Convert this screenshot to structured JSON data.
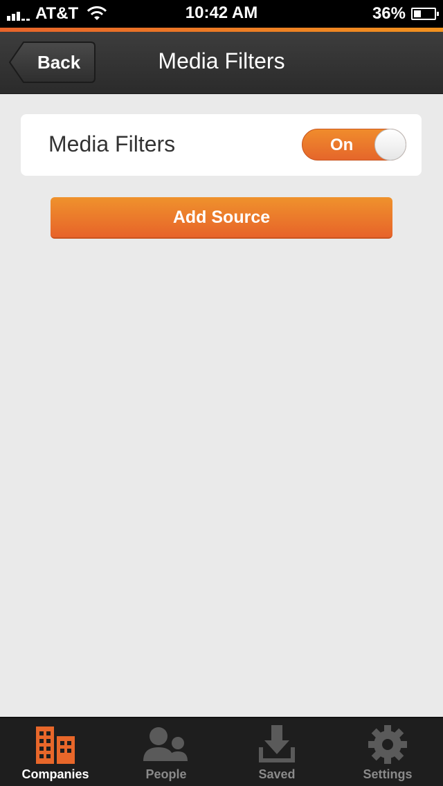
{
  "status_bar": {
    "carrier": "AT&T",
    "time": "10:42 AM",
    "battery_percent": "36%",
    "battery_level": 0.36
  },
  "nav": {
    "back_label": "Back",
    "title": "Media Filters"
  },
  "filter": {
    "label": "Media Filters",
    "toggle_label": "On",
    "toggle_state": true
  },
  "add_source": {
    "label": "Add Source"
  },
  "colors": {
    "accent": "#e8672a",
    "nav_bg": "#333333",
    "tab_bg": "#1e1e1e",
    "page_bg": "#eaeaea"
  },
  "tabs": [
    {
      "label": "Companies",
      "icon": "companies-icon",
      "active": true
    },
    {
      "label": "People",
      "icon": "people-icon",
      "active": false
    },
    {
      "label": "Saved",
      "icon": "saved-icon",
      "active": false
    },
    {
      "label": "Settings",
      "icon": "settings-icon",
      "active": false
    }
  ]
}
